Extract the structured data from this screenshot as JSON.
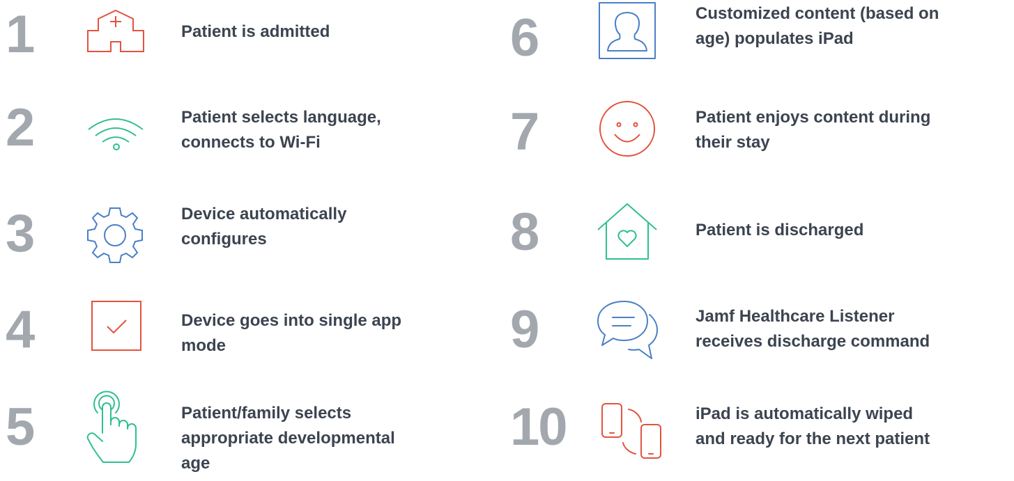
{
  "steps": [
    {
      "number": "1",
      "icon": "hospital-icon",
      "lines": [
        "Patient is admitted"
      ]
    },
    {
      "number": "2",
      "icon": "wifi-icon",
      "lines": [
        "Patient selects language,",
        "connects to Wi-Fi"
      ]
    },
    {
      "number": "3",
      "icon": "gear-icon",
      "lines": [
        "Device automatically",
        "configures"
      ]
    },
    {
      "number": "4",
      "icon": "checkbox-icon",
      "lines": [
        "Device goes into single app",
        "mode"
      ]
    },
    {
      "number": "5",
      "icon": "hand-pointer-icon",
      "lines": [
        "Patient/family selects",
        "appropriate developmental",
        "age"
      ]
    },
    {
      "number": "6",
      "icon": "user-profile-icon",
      "lines": [
        "Customized content (based on",
        "age) populates iPad"
      ]
    },
    {
      "number": "7",
      "icon": "smiley-face-icon",
      "lines": [
        "Patient enjoys content during",
        "their stay"
      ]
    },
    {
      "number": "8",
      "icon": "home-heart-icon",
      "lines": [
        "Patient is discharged"
      ]
    },
    {
      "number": "9",
      "icon": "chat-bubbles-icon",
      "lines": [
        "Jamf Healthcare Listener",
        "receives discharge command"
      ]
    },
    {
      "number": "10",
      "icon": "device-transfer-icon",
      "lines": [
        "iPad is automatically wiped",
        "and ready for the next patient"
      ]
    }
  ],
  "colors": {
    "number": "#a3a8af",
    "text": "#3c4450",
    "red": "#e2533f",
    "green": "#2fbf8f",
    "blue": "#4a7fc7"
  }
}
